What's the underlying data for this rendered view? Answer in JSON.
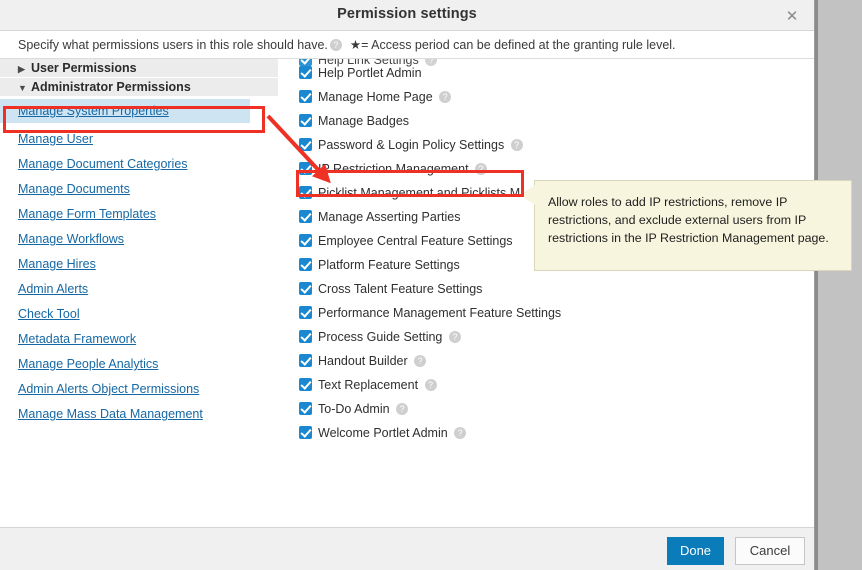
{
  "dialog": {
    "title": "Permission settings",
    "close_icon": "close-icon",
    "instruction": "Specify what permissions users in this role should have.",
    "instruction_help_icon": "help-icon",
    "star_note": "★= Access period can be defined at the granting rule level."
  },
  "sidebar": {
    "groups": [
      {
        "caret": "▶",
        "label": "User Permissions",
        "expanded": false
      },
      {
        "caret": "▼",
        "label": "Administrator Permissions",
        "expanded": true
      }
    ],
    "items": [
      {
        "label": "Manage System Properties",
        "selected": true
      },
      {
        "label": "Manage User",
        "selected": false
      },
      {
        "label": "Manage Document Categories",
        "selected": false
      },
      {
        "label": "Manage Documents",
        "selected": false
      },
      {
        "label": "Manage Form Templates",
        "selected": false
      },
      {
        "label": "Manage Workflows",
        "selected": false
      },
      {
        "label": "Manage Hires",
        "selected": false
      },
      {
        "label": "Admin Alerts",
        "selected": false
      },
      {
        "label": "Check Tool",
        "selected": false
      },
      {
        "label": "Metadata Framework",
        "selected": false
      },
      {
        "label": "Manage People Analytics",
        "selected": false
      },
      {
        "label": "Admin Alerts Object Permissions",
        "selected": false
      },
      {
        "label": "Manage Mass Data Management",
        "selected": false
      }
    ]
  },
  "permissions": {
    "clipped_top_item": {
      "label": "Help Link Settings",
      "checked": true,
      "help": true
    },
    "items": [
      {
        "label": "Help Portlet Admin",
        "checked": true,
        "help": false
      },
      {
        "label": "Manage Home Page",
        "checked": true,
        "help": true
      },
      {
        "label": "Manage Badges",
        "checked": true,
        "help": false
      },
      {
        "label": "Password & Login Policy Settings",
        "checked": true,
        "help": true
      },
      {
        "label": "IP Restriction Management",
        "checked": true,
        "help": true,
        "highlighted": true
      },
      {
        "label": "Picklist Management and Picklists M",
        "checked": true,
        "help": false
      },
      {
        "label": "Manage Asserting Parties",
        "checked": true,
        "help": false
      },
      {
        "label": "Employee Central Feature Settings",
        "checked": true,
        "help": false
      },
      {
        "label": "Platform Feature Settings",
        "checked": true,
        "help": false
      },
      {
        "label": "Cross Talent Feature Settings",
        "checked": true,
        "help": false
      },
      {
        "label": "Performance Management Feature Settings",
        "checked": true,
        "help": false
      },
      {
        "label": "Process Guide Setting",
        "checked": true,
        "help": true
      },
      {
        "label": "Handout Builder",
        "checked": true,
        "help": true
      },
      {
        "label": "Text Replacement",
        "checked": true,
        "help": true
      },
      {
        "label": "To-Do Admin",
        "checked": true,
        "help": true
      },
      {
        "label": "Welcome Portlet Admin",
        "checked": true,
        "help": true
      }
    ]
  },
  "tooltip": {
    "text": "Allow roles to add IP restrictions, remove IP restrictions, and exclude external users from IP restrictions in the IP Restriction Management page."
  },
  "footer": {
    "done_label": "Done",
    "cancel_label": "Cancel"
  },
  "colors": {
    "accent_blue": "#0a7cb9",
    "checkbox_blue": "#1a88d0",
    "link_blue": "#1668a4",
    "selected_row": "#cfe4f2",
    "tooltip_bg": "#f7f5dd",
    "annotation_red": "#ee3124"
  }
}
